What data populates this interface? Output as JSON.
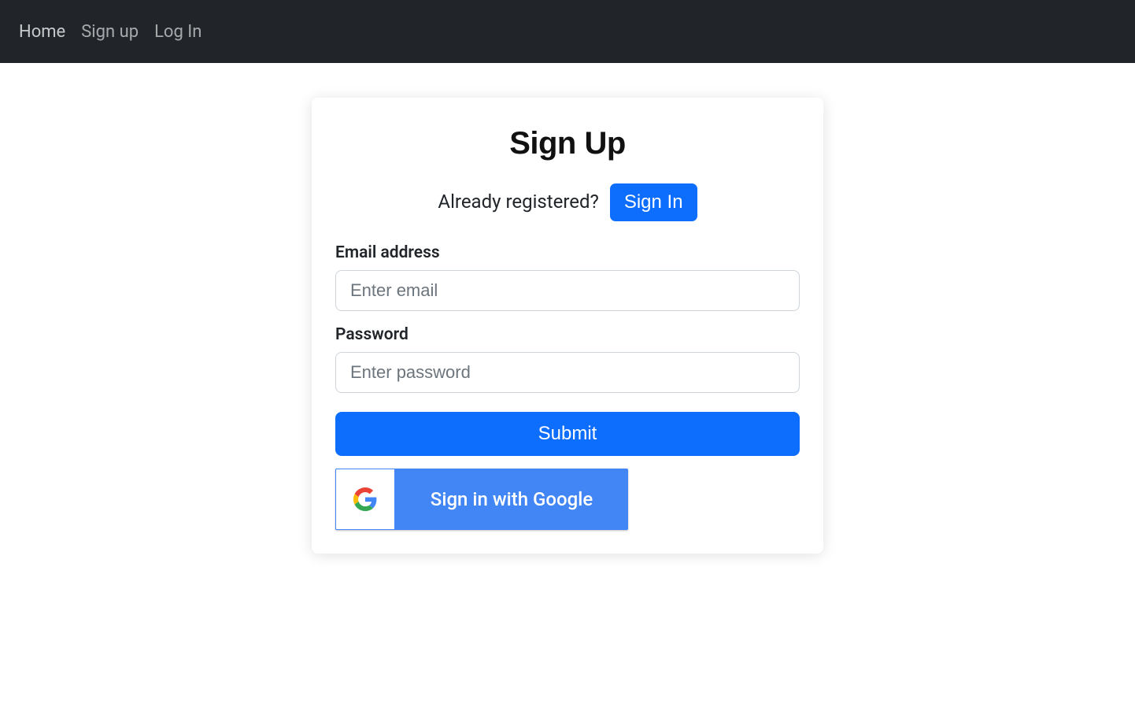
{
  "nav": {
    "home": "Home",
    "signup": "Sign up",
    "login": "Log In"
  },
  "card": {
    "title": "Sign Up",
    "already_text": "Already registered? ",
    "signin_button": "Sign In",
    "email_label": "Email address",
    "email_placeholder": "Enter email",
    "password_label": "Password",
    "password_placeholder": "Enter password",
    "submit_label": "Submit",
    "google_label": "Sign in with Google"
  }
}
